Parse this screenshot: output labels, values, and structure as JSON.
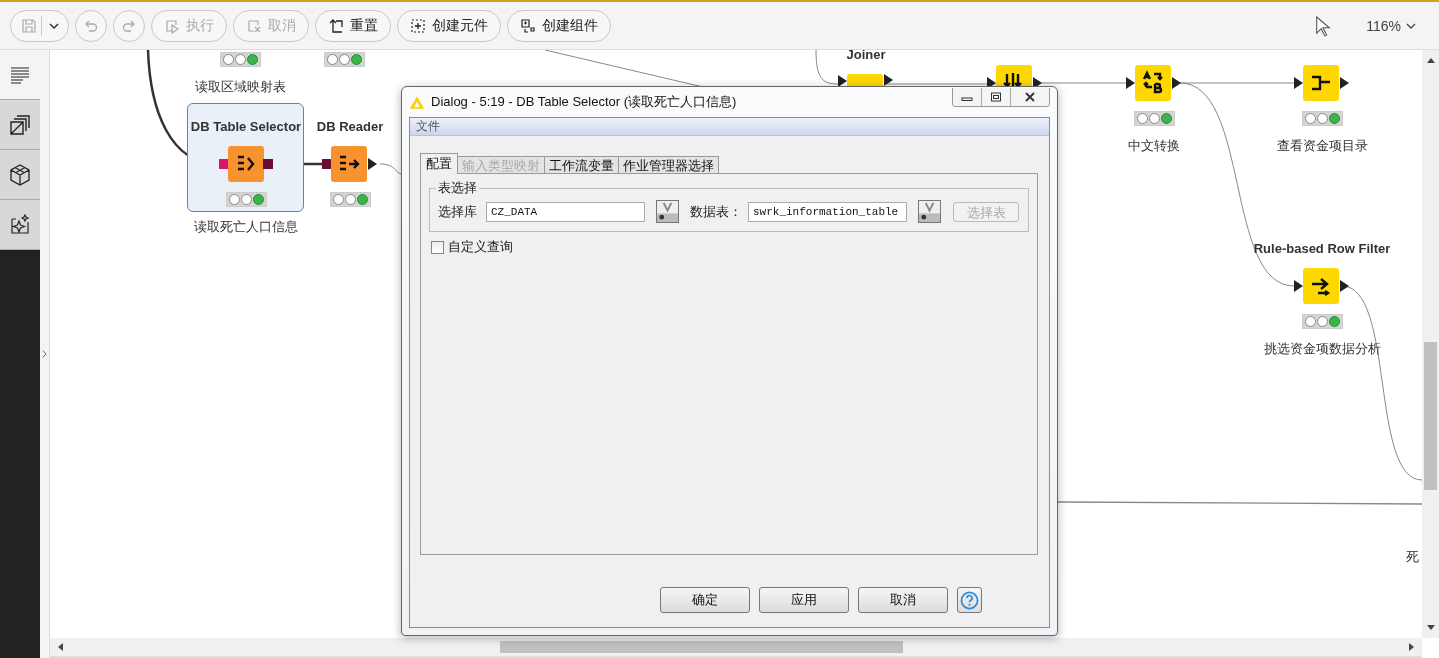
{
  "toolbar": {
    "buttons": [
      {
        "kind": "save",
        "disabled": true
      },
      {
        "kind": "undo",
        "disabled": true
      },
      {
        "kind": "redo",
        "disabled": true
      },
      {
        "kind": "execute",
        "label": "执行",
        "disabled": true
      },
      {
        "kind": "cancel",
        "label": "取消",
        "disabled": true
      },
      {
        "kind": "reset",
        "label": "重置",
        "disabled": false
      },
      {
        "kind": "metanode",
        "label": "创建元件",
        "disabled": false
      },
      {
        "kind": "component",
        "label": "创建组件",
        "disabled": false
      }
    ],
    "zoom": "116%"
  },
  "sidebar": {
    "items": [
      {
        "kind": "description",
        "selected": true
      },
      {
        "kind": "nodes",
        "selected": false
      },
      {
        "kind": "components",
        "selected": false
      },
      {
        "kind": "assistant",
        "selected": false
      }
    ]
  },
  "canvas": {
    "nodes": [
      {
        "kind": "clipped",
        "executed": true,
        "label": "读取区域映射表"
      },
      {
        "kind": "clipped",
        "executed": true
      },
      {
        "kind": "db-table-selector",
        "title": "DB Table Selector",
        "color": "#f7922e",
        "executed": true,
        "label": "读取死亡人口信息",
        "selected": true
      },
      {
        "kind": "db-reader",
        "title": "DB Reader",
        "color": "#f7922e",
        "executed": true,
        "selected": false
      },
      {
        "kind": "joiner",
        "title": "Joiner",
        "color": "#ffd800",
        "selected": false
      },
      {
        "kind": "column-op",
        "color": "#ffd800",
        "selected": false
      },
      {
        "kind": "string-convert",
        "color": "#ffd800",
        "executed": true,
        "label": "中文转换",
        "selected": false
      },
      {
        "kind": "view",
        "color": "#ffd800",
        "executed": true,
        "label": "查看资金项目录",
        "selected": false
      },
      {
        "kind": "row-filter",
        "title": "Rule-based Row Filter",
        "color": "#ffd800",
        "executed": true,
        "label": "挑选资金项数据分析",
        "selected": false
      }
    ],
    "partial_labels": [
      "死"
    ]
  },
  "dialog": {
    "title": "Dialog - 5:19 - DB Table Selector (读取死亡人口信息)",
    "menu": [
      "文件"
    ],
    "tabs": [
      {
        "label": "配置",
        "selected": true,
        "disabled": false
      },
      {
        "label": "输入类型映射",
        "selected": false,
        "disabled": true
      },
      {
        "label": "工作流变量",
        "selected": false,
        "disabled": false
      },
      {
        "label": "作业管理器选择",
        "selected": false,
        "disabled": false
      }
    ],
    "group": {
      "title": "表选择",
      "fields": [
        {
          "label": "选择库",
          "value": "CZ_DATA"
        },
        {
          "label": "数据表：",
          "value": "swrk_information_table"
        }
      ],
      "select_button": {
        "label": "选择表",
        "disabled": true
      }
    },
    "custom_query": {
      "label": "自定义查询",
      "checked": false
    },
    "buttons": [
      {
        "label": "确定"
      },
      {
        "label": "应用"
      },
      {
        "label": "取消"
      }
    ],
    "help": true
  }
}
